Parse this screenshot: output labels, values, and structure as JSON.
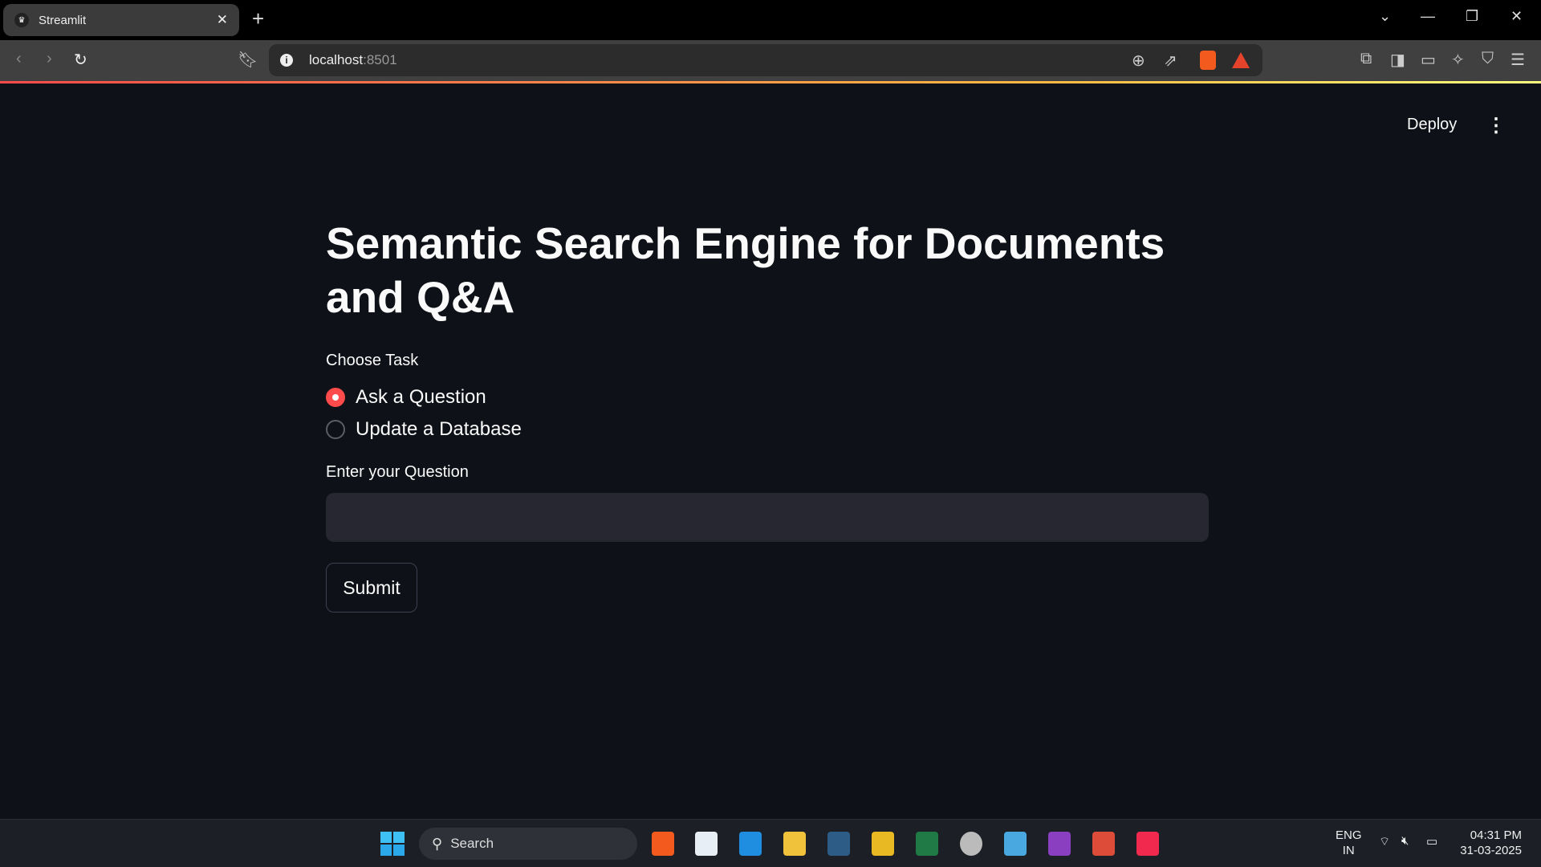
{
  "browser": {
    "tab_title": "Streamlit",
    "url_host": "localhost",
    "url_port": ":8501"
  },
  "header": {
    "deploy_label": "Deploy",
    "menu_icon": "kebab-menu-icon"
  },
  "main": {
    "title": "Semantic Search Engine for Documents and Q&A",
    "task_label": "Choose Task",
    "options": [
      {
        "label": "Ask a Question",
        "selected": true
      },
      {
        "label": "Update a Database",
        "selected": false
      }
    ],
    "question_label": "Enter your Question",
    "question_value": "",
    "submit_label": "Submit"
  },
  "taskbar": {
    "search_label": "Search",
    "lang_line1": "ENG",
    "lang_line2": "IN",
    "time": "04:31 PM",
    "date": "31-03-2025"
  },
  "colors": {
    "accent": "#ff4b4b",
    "background": "#0e1117",
    "input_bg": "#262730"
  }
}
